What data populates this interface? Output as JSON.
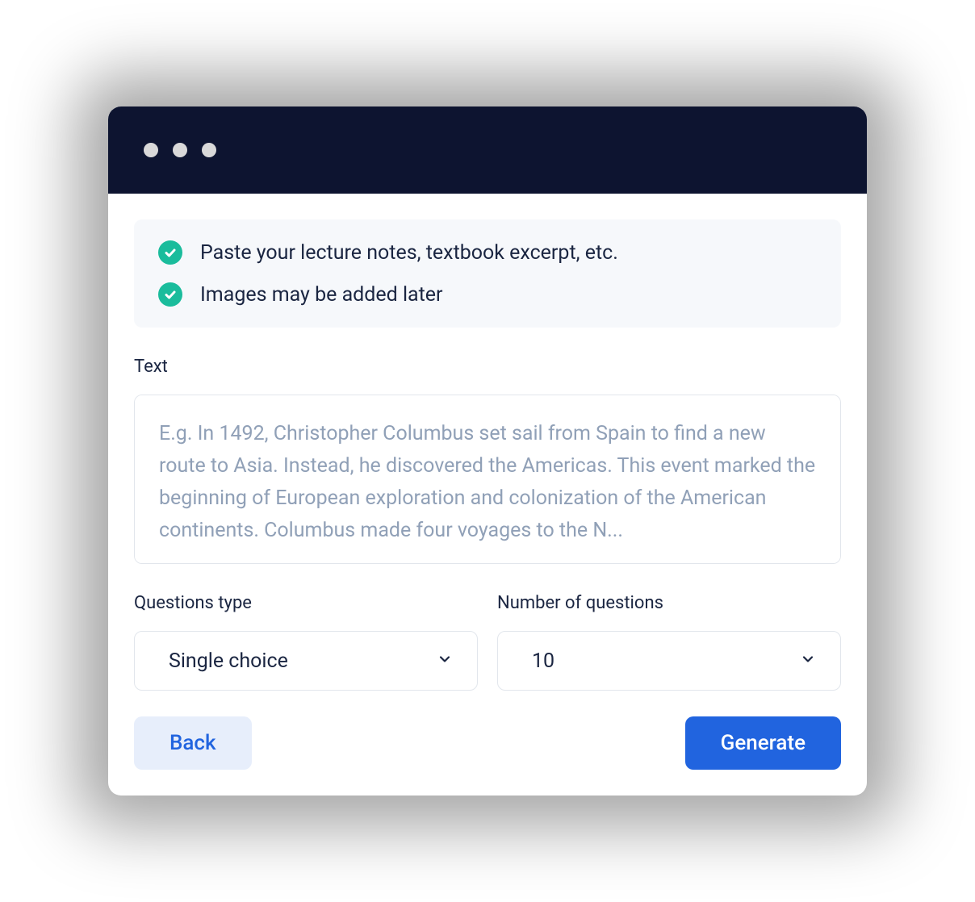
{
  "info": {
    "items": [
      "Paste your lecture notes, textbook excerpt, etc.",
      "Images may be added later"
    ]
  },
  "form": {
    "text_label": "Text",
    "text_placeholder": "E.g. In 1492, Christopher Columbus set sail from Spain to find a new route to Asia. Instead, he discovered the Americas. This event marked the beginning of European exploration and colonization of the American continents. Columbus made four voyages to the N...",
    "question_type_label": "Questions type",
    "question_type_value": "Single choice",
    "number_label": "Number of questions",
    "number_value": "10"
  },
  "actions": {
    "back_label": "Back",
    "generate_label": "Generate"
  }
}
